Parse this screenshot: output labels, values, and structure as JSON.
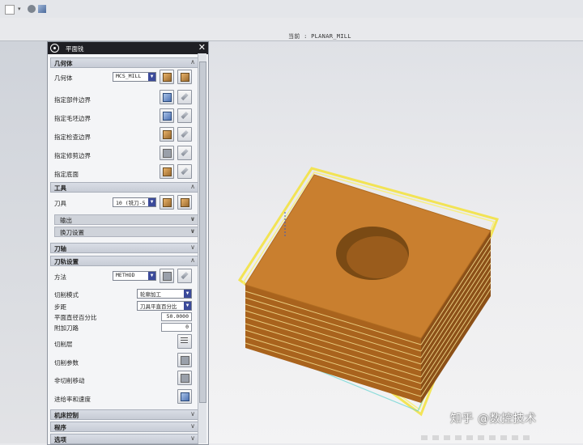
{
  "statusbar": {
    "current_label": "当前 : PLANAR_MILL"
  },
  "panel": {
    "title": "平面铣",
    "sections": {
      "geometry": "几何体",
      "tool": "工具",
      "tool_axis": "刀轴",
      "path_settings": "刀轨设置",
      "machine_control": "机床控制",
      "program": "程序",
      "options": "选项"
    },
    "geometry": {
      "geometry_label": "几何体",
      "geometry_value": "MCS_MILL",
      "rows": [
        "指定部件边界",
        "指定毛坯边界",
        "指定检查边界",
        "指定修剪边界",
        "指定底面"
      ]
    },
    "tool": {
      "tool_label": "刀具",
      "tool_value": "10 (铣刀-5",
      "output": "输出",
      "tool_change": "换刀设置"
    },
    "path": {
      "method_label": "方法",
      "method_value": "METHOD",
      "cut_mode_label": "切削模式",
      "cut_mode_value": "轮廓加工",
      "stepover_label": "步距",
      "stepover_value": "刀具平直百分比",
      "percent_label": "平面直径百分比",
      "percent_value": "50.0000",
      "additional_label": "附加刀路",
      "additional_value": "0",
      "levels_label": "切削层",
      "params_label": "切削参数",
      "noncut_label": "非切削移动",
      "feeds_label": "进给率和速度"
    }
  },
  "watermark": "知乎 @数控技术",
  "colors": {
    "part_top": "#c97f2f",
    "part_side": "#a9631d",
    "highlight": "#f3e23a",
    "hole": "#7a4a14"
  }
}
